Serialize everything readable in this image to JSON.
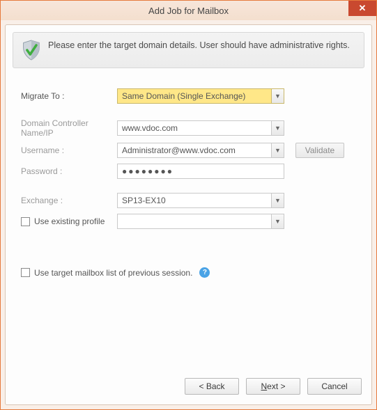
{
  "window": {
    "title": "Add Job for Mailbox"
  },
  "banner": {
    "text": "Please enter the target domain details. User should have administrative rights."
  },
  "form": {
    "migrate_to_label": "Migrate To :",
    "migrate_to_value": "Same Domain (Single Exchange)",
    "dc_label": "Domain Controller Name/IP",
    "dc_value": "www.vdoc.com",
    "username_label": "Username :",
    "username_value": "Administrator@www.vdoc.com",
    "password_label": "Password :",
    "password_value": "●●●●●●●●",
    "exchange_label": "Exchange :",
    "exchange_value": "SP13-EX10",
    "use_existing_label": "Use existing profile",
    "profile_value": "",
    "validate_label": "Validate",
    "prev_session_label": "Use target mailbox list of previous session."
  },
  "buttons": {
    "back": "< Back",
    "next_prefix": "N",
    "next_rest": "ext >",
    "cancel": "Cancel"
  }
}
